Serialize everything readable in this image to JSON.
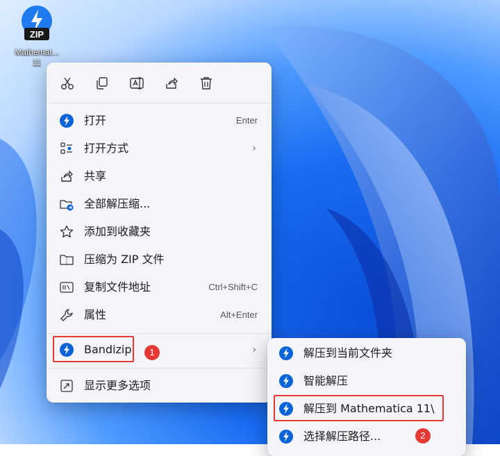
{
  "desktop": {
    "icon_badge": "ZIP",
    "icon_label_line1": "Mathemat...",
    "icon_label_line2": "11"
  },
  "quick_actions": [
    {
      "name": "cut-icon"
    },
    {
      "name": "copy-icon"
    },
    {
      "name": "rename-icon"
    },
    {
      "name": "share-icon"
    },
    {
      "name": "delete-icon"
    }
  ],
  "menu": {
    "items": [
      {
        "label": "打开",
        "shortcut": "Enter",
        "icon": "bandizip-icon"
      },
      {
        "label": "打开方式",
        "shortcut": "",
        "icon": "open-with-icon",
        "submenu": true
      },
      {
        "label": "共享",
        "shortcut": "",
        "icon": "share-icon"
      },
      {
        "label": "全部解压缩...",
        "shortcut": "",
        "icon": "extract-all-icon"
      },
      {
        "label": "添加到收藏夹",
        "shortcut": "",
        "icon": "star-icon"
      },
      {
        "label": "压缩为 ZIP 文件",
        "shortcut": "",
        "icon": "zip-folder-icon"
      },
      {
        "label": "复制文件地址",
        "shortcut": "Ctrl+Shift+C",
        "icon": "copy-path-icon"
      },
      {
        "label": "属性",
        "shortcut": "Alt+Enter",
        "icon": "wrench-icon"
      }
    ],
    "bandizip": {
      "label": "Bandizip",
      "badge": "1"
    },
    "more": {
      "label": "显示更多选项"
    }
  },
  "submenu": {
    "items": [
      {
        "label": "解压到当前文件夹"
      },
      {
        "label": "智能解压"
      },
      {
        "label": "解压到 Mathematica 11\\"
      },
      {
        "label": "选择解压路径..."
      }
    ],
    "badge": "2"
  },
  "colors": {
    "accent": "#0a64d8",
    "highlight": "#e53935",
    "menu_bg": "#f3f5f9"
  }
}
